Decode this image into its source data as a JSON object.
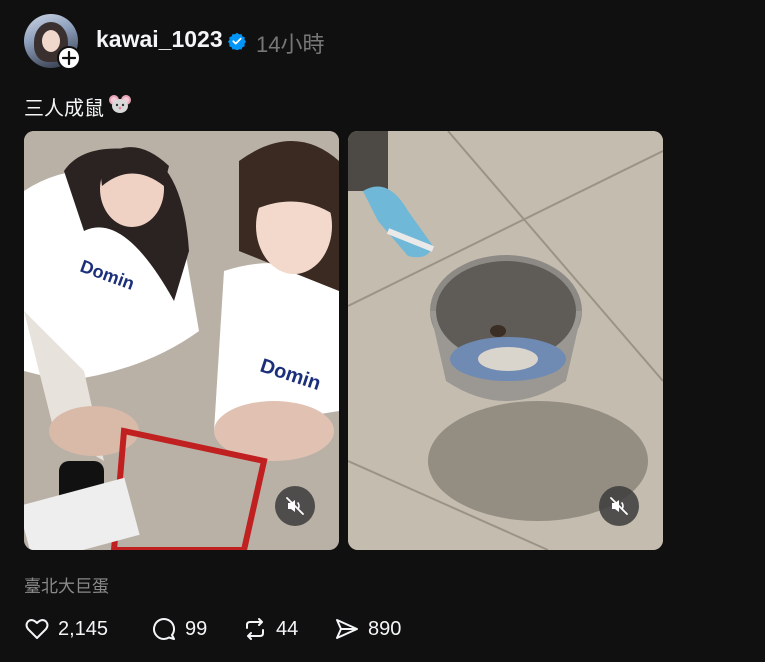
{
  "post": {
    "username": "kawai_1023",
    "time": "14小時",
    "caption": "三人成鼠",
    "caption_emoji": "mouse-face-emoji",
    "location": "臺北大巨蛋"
  },
  "media": [
    {
      "kind": "video",
      "description_icon": "muted-speaker-icon"
    },
    {
      "kind": "video",
      "description_icon": "muted-speaker-icon"
    }
  ],
  "actions": {
    "likes": "2,145",
    "comments": "99",
    "reposts": "44",
    "shares": "890"
  },
  "colors": {
    "background": "#101010",
    "text": "#f3f5f7",
    "muted": "#777777",
    "verified": "#0095f6"
  }
}
